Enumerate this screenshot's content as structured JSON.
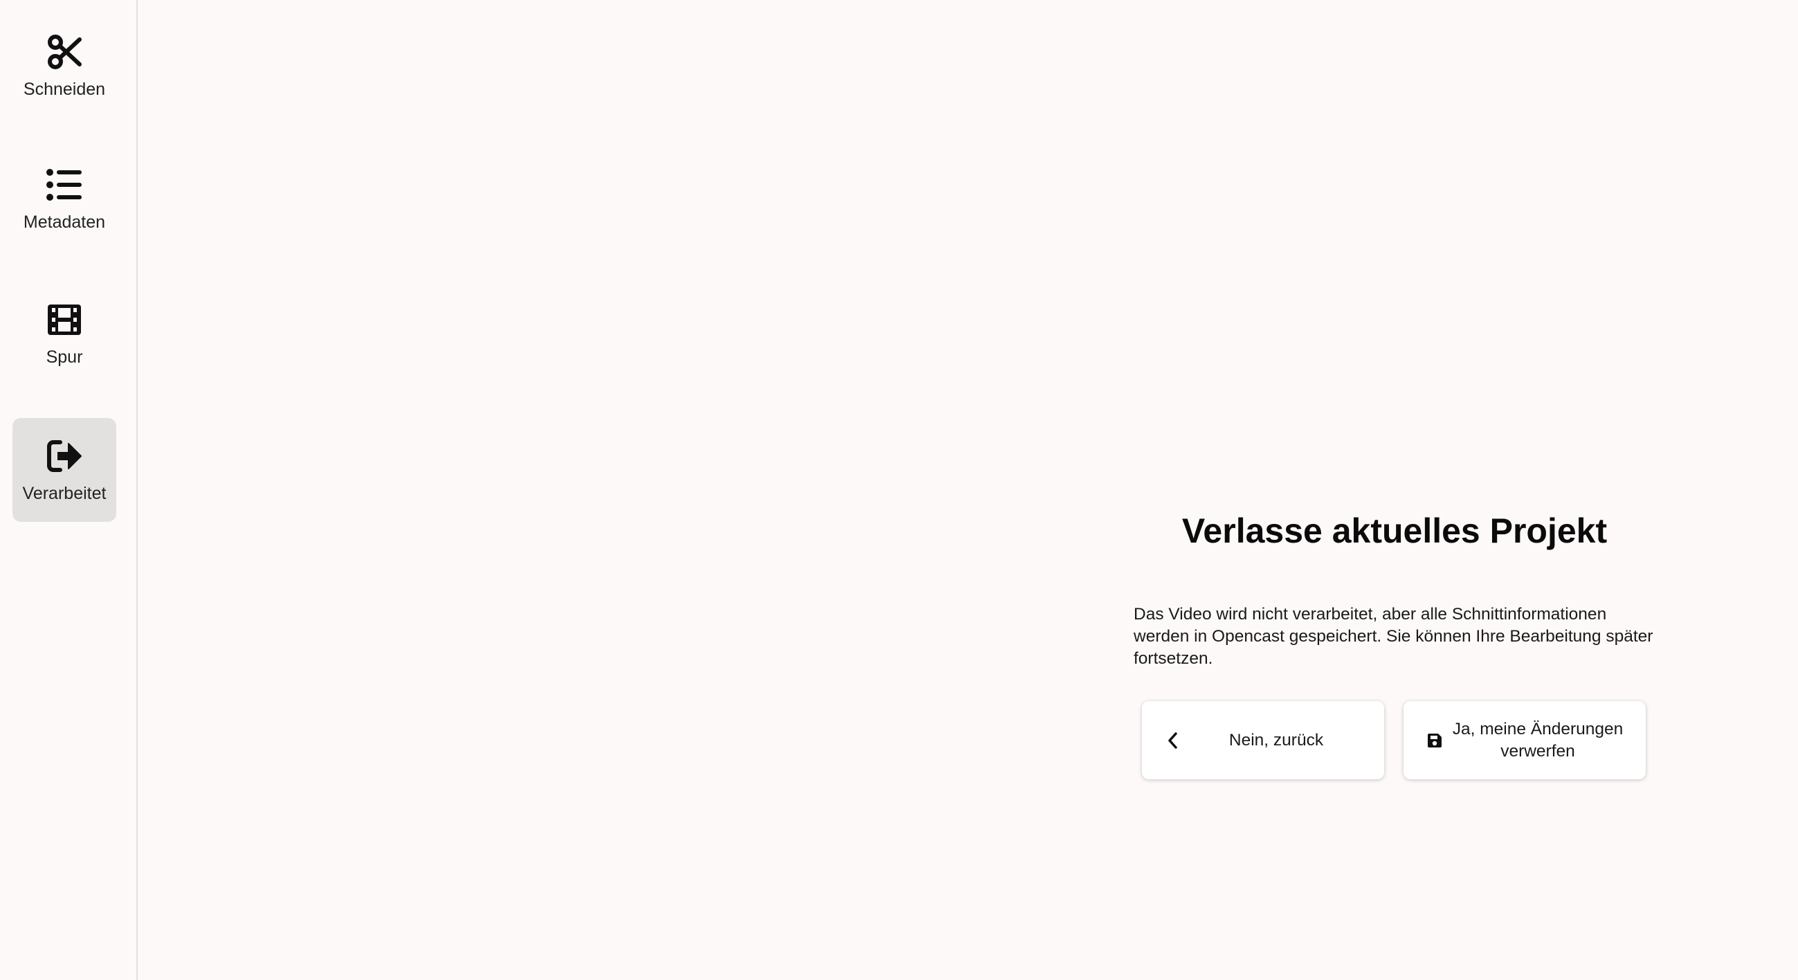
{
  "sidebar": {
    "items": [
      {
        "label": "Schneiden",
        "icon": "scissors-icon",
        "active": false
      },
      {
        "label": "Metadaten",
        "icon": "list-icon",
        "active": false
      },
      {
        "label": "Spur",
        "icon": "film-icon",
        "active": false
      },
      {
        "label": "Verarbeitet",
        "icon": "sign-out-icon",
        "active": true
      }
    ]
  },
  "dialog": {
    "title": "Verlasse aktuelles Projekt",
    "message": "Das Video wird nicht verarbeitet, aber alle Schnittinformationen werden in Opencast gespeichert. Sie können Ihre Bearbeitung später fortsetzen.",
    "back_button": {
      "label": "Nein, zurück",
      "icon": "chevron-left-icon"
    },
    "discard_button": {
      "label": "Ja, meine Änderungen verwerfen",
      "icon": "save-icon"
    }
  },
  "colors": {
    "background": "#fdf9f8",
    "sidebar_active": "#e3e1e0",
    "text": "#111111",
    "button_bg": "#ffffff"
  }
}
